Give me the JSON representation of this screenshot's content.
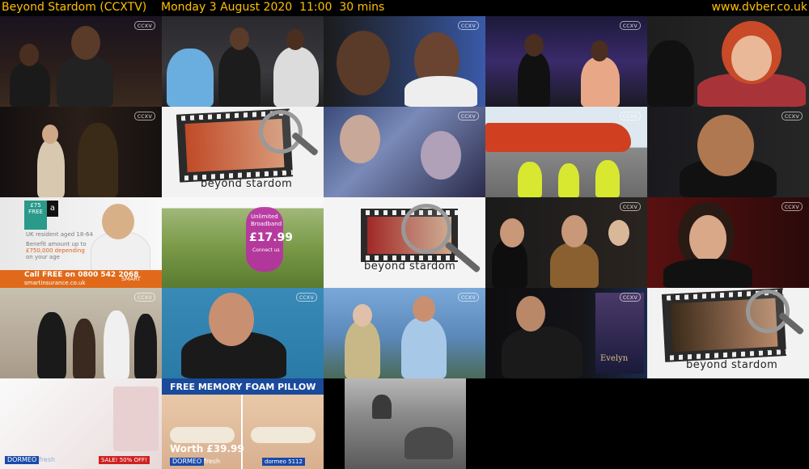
{
  "header": {
    "title": "Beyond Stardom (CCXTV)    Monday 3 August 2020  11:00  30 mins",
    "site": "www.dvber.co.uk"
  },
  "channel_logo": "ccxv",
  "brand_text": "beyond stardom",
  "insurance_ad": {
    "badge": "£75 FREE",
    "logo": "a",
    "line1": "UK resident aged 18-64",
    "line2": "Benefit amount up to",
    "line3": "£750,000 depending",
    "line4": "on your age",
    "phone": "Call FREE on 0800 542 2068",
    "url": "smartinsurance.co.uk",
    "brand": "SMART"
  },
  "broadband_ad": {
    "line1": "Unlimited",
    "line2": "Broadband",
    "price": "£17.99",
    "suffix": "Connect us"
  },
  "pillow_ad": {
    "headline": "FREE MEMORY FOAM PILLOW",
    "price": "Worth £39.99",
    "logo": "DORMEO",
    "logo_suffix": "fresh",
    "code": "dormeo 5112"
  },
  "dormeo_ad": {
    "logo": "DORMEO",
    "logo_suffix": "fresh",
    "sale": "SALE! 50% OFF!"
  },
  "poster_text": "Evelyn"
}
